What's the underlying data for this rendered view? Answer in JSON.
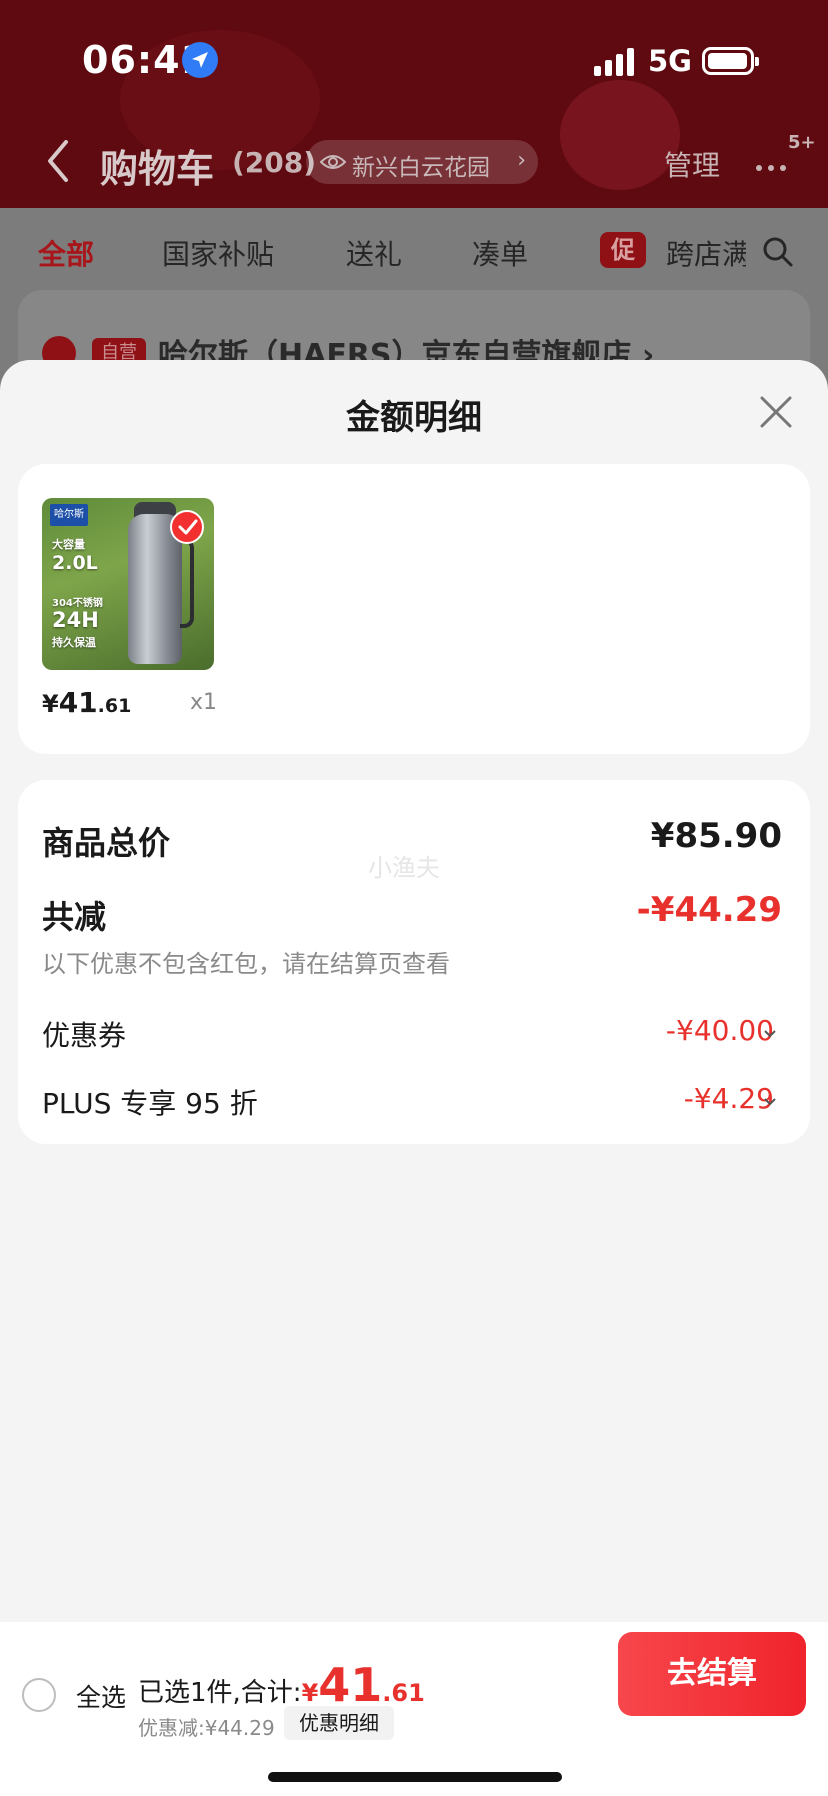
{
  "status_bar": {
    "time": "06:41",
    "network": "5G"
  },
  "background": {
    "nav": {
      "title": "购物车",
      "count": "(208)",
      "location": "新兴白云花园",
      "manage": "管理",
      "more_badge": "5+"
    },
    "tabs": [
      {
        "label": "全部",
        "active": true
      },
      {
        "label": "国家补贴",
        "active": false
      },
      {
        "label": "送礼",
        "active": false
      },
      {
        "label": "凑单",
        "active": false
      },
      {
        "label": "跨店满",
        "active": false
      }
    ],
    "promo_tag": "促",
    "store": {
      "tag": "自营",
      "name": "哈尔斯（HAERS）京东自营旗舰店 ›"
    }
  },
  "sheet": {
    "title": "金额明细",
    "product": {
      "price_yen": "¥",
      "price_int": "41",
      "price_dec": ".61",
      "quantity": "x1",
      "image_texts": {
        "brand": "哈尔斯",
        "capacity_label": "大容量",
        "capacity": "2.0L",
        "material": "304不锈钢",
        "hours": "24H",
        "keep_warm": "持久保温"
      }
    },
    "summary": {
      "total_label": "商品总价",
      "total_value": "¥85.90",
      "watermark": "小渔夫",
      "reduce_label": "共减",
      "reduce_value": "-¥44.29",
      "reduce_note": "以下优惠不包含红包，请在结算页查看",
      "items": [
        {
          "label": "优惠券",
          "value": "-¥40.00"
        },
        {
          "label": "PLUS 专享 95 折",
          "value": "-¥4.29"
        }
      ]
    }
  },
  "bottom_bar": {
    "select_all": "全选",
    "selected_prefix": "已选1件,合计:",
    "sum_yen": "¥",
    "sum_int": "41",
    "sum_dec": ".61",
    "discount": "优惠减:¥44.29",
    "detail_chip": "优惠明细",
    "checkout": "去结算"
  },
  "colors": {
    "accent": "#e8312c",
    "checkout": "#f0232b",
    "header_dim": "#5f0a10"
  }
}
